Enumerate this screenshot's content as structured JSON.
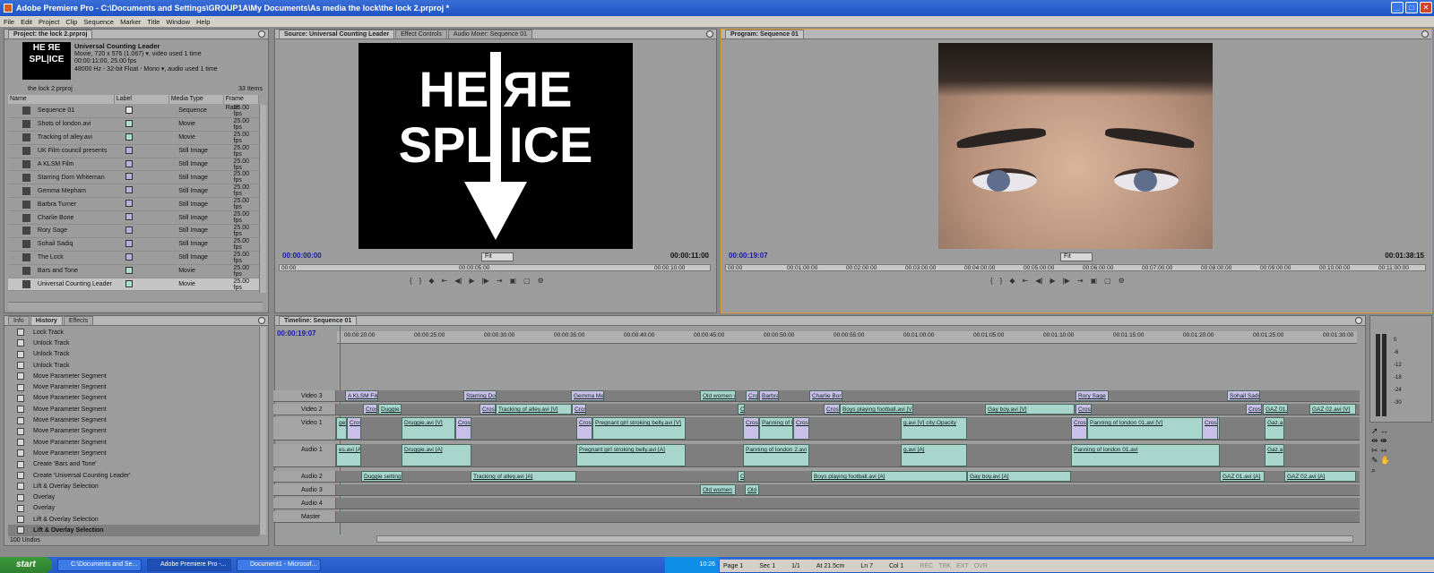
{
  "window": {
    "title": "Adobe Premiere Pro - C:\\Documents and Settings\\GROUP1A\\My Documents\\As media the lock\\the lock 2.prproj *",
    "buttons": [
      "_",
      "□",
      "✕"
    ]
  },
  "menu": [
    "File",
    "Edit",
    "Project",
    "Clip",
    "Sequence",
    "Marker",
    "Title",
    "Window",
    "Help"
  ],
  "project": {
    "tab": "Project: the lock 2.prproj",
    "thumb_lines": [
      "HE ЯE",
      "SPL|ICE"
    ],
    "preview": {
      "name": "Universal Counting Leader",
      "info1": "Movie, 720 x 576 (1.067)  ▾, video used 1 time",
      "info2": "00:00:11:00, 25.00 fps",
      "info3": "48000 Hz - 32-bit Float - Mono  ▾, audio used 1 time"
    },
    "bin_name": "the lock 2.prproj",
    "item_count": "33 Items",
    "columns": [
      "Name",
      "Label",
      "Media Type",
      "Frame Rate"
    ],
    "items": [
      {
        "name": "Sequence 01",
        "type": "Sequence",
        "rate": "25.00 fps",
        "color": "#e8e8e8"
      },
      {
        "name": "Shots of london.avi",
        "type": "Movie",
        "rate": "25.00 fps",
        "color": "#a8e0d0"
      },
      {
        "name": "Tracking of alley.avi",
        "type": "Movie",
        "rate": "25.00 fps",
        "color": "#a8e0d0"
      },
      {
        "name": "UK Film council presents",
        "type": "Still Image",
        "rate": "25.00 fps",
        "color": "#b8b0e0"
      },
      {
        "name": "A KLSM Film",
        "type": "Still Image",
        "rate": "25.00 fps",
        "color": "#b8b0e0"
      },
      {
        "name": "Starring Dom Whiteman",
        "type": "Still Image",
        "rate": "25.00 fps",
        "color": "#b8b0e0"
      },
      {
        "name": "Gemma Mepham",
        "type": "Still Image",
        "rate": "25.00 fps",
        "color": "#b8b0e0"
      },
      {
        "name": "Barbra Turner",
        "type": "Still Image",
        "rate": "25.00 fps",
        "color": "#b8b0e0"
      },
      {
        "name": "Charlie Bone",
        "type": "Still Image",
        "rate": "25.00 fps",
        "color": "#b8b0e0"
      },
      {
        "name": "Rory Sage",
        "type": "Still Image",
        "rate": "25.00 fps",
        "color": "#b8b0e0"
      },
      {
        "name": "Sohail Sadiq",
        "type": "Still Image",
        "rate": "25.00 fps",
        "color": "#b8b0e0"
      },
      {
        "name": "The Lock",
        "type": "Still Image",
        "rate": "25.00 fps",
        "color": "#b8b0e0"
      },
      {
        "name": "Bars and Tone",
        "type": "Movie",
        "rate": "25.00 fps",
        "color": "#a8e0d0"
      },
      {
        "name": "Universal Counting Leader",
        "type": "Movie",
        "rate": "25.00 fps",
        "color": "#a8e0d0"
      }
    ]
  },
  "history": {
    "tabs": [
      "Info",
      "History",
      "Effects"
    ],
    "items": [
      "Lock Track",
      "Unlock Track",
      "Unlock Track",
      "Unlock Track",
      "Move Parameter Segment",
      "Move Parameter Segment",
      "Move Parameter Segment",
      "Move Parameter Segment",
      "Move Parameter Segment",
      "Move Parameter Segment",
      "Move Parameter Segment",
      "Move Parameter Segment",
      "Create 'Bars and Tone'",
      "Create 'Universal Counting Leader'",
      "Lift & Overlay Selection",
      "Overlay",
      "Overlay",
      "Lift & Overlay Selection",
      "Lift & Overlay Selection"
    ],
    "footer": "100 Undos"
  },
  "source": {
    "tabs": [
      "Source: Universal Counting Leader",
      "Effect Controls",
      "Audio Mixer: Sequence 01"
    ],
    "frame_lines": [
      "HE ЯE",
      "SPL ICE"
    ],
    "tc_in": "00:00:00:00",
    "fit": "Fit",
    "duration": "00:00:11:00",
    "ruler": [
      "00:00",
      "00:00:05:00",
      "00:00:10:00"
    ]
  },
  "program": {
    "tab": "Program: Sequence 01",
    "tc_in": "00:00:19:07",
    "fit": "Fit",
    "duration": "00:01:38:15",
    "ruler": [
      "00:00",
      "00:01:00:00",
      "00:02:00:00",
      "00:03:00:00",
      "00:04:00:00",
      "00:05:00:00",
      "00:06:00:00",
      "00:07:00:00",
      "00:08:00:00",
      "00:09:00:00",
      "00:10:00:00",
      "00:11:00:00"
    ]
  },
  "timeline": {
    "tab": "Timeline: Sequence 01",
    "tc": "00:00:19:07",
    "ruler": [
      "00:00:20:00",
      "00:00:25:00",
      "00:00:30:00",
      "00:00:35:00",
      "00:00:40:00",
      "00:00:45:00",
      "00:00:50:00",
      "00:00:55:00",
      "00:01:00:00",
      "00:01:05:00",
      "00:01:10:00",
      "00:01:15:00",
      "00:01:20:00",
      "00:01:25:00",
      "00:01:30:00"
    ],
    "tracks": [
      "Video 3",
      "Video 2",
      "Video 1",
      "Audio 1",
      "Audio 2",
      "Audio 3",
      "Audio 4",
      "Master"
    ],
    "clips": {
      "v3": [
        "A KLSM Film",
        "Starring Do",
        "Gemma Mep",
        "Old women w",
        "Cros",
        "Barbra",
        "Charlie Bon",
        "Rory Sage",
        "Sohail Sadiq"
      ],
      "v2": [
        "Cross",
        "Duggie s",
        "Cross",
        "Tracking of alley.avi [V]",
        "Cross",
        "O",
        "Cross",
        "Boys playing football.avi [V",
        "Gay boy.avi [V]",
        "Cross",
        "Cross",
        "GAZ 01.a",
        "GAZ 02.avi [V]"
      ],
      "v1": [
        "ges",
        "Cross",
        "Druggie.avi [V]",
        "Cross",
        "Cross",
        "Pregnant girl stroking belly.avi [V]",
        "Cross",
        "Panning of l",
        "Cross",
        "g.avi [V] city:Opacity",
        "Cross",
        "Panning of london 01.avi [V]",
        "Cross",
        "Gaz.a"
      ],
      "a1": [
        "es.avi [A]",
        "Druggie.avi [A]",
        "Pregnant girl stroking belly.avi [A]",
        "Panning of london 2.avi",
        "g.avi [A]",
        "Panning of london 01.avi",
        "Gaz.a"
      ],
      "a2": [
        "Duggie setting",
        "Tracking of alley.avi [A]",
        "O",
        "Boys playing football.avi [A]",
        "Gay boy.avi [A]",
        "GAZ 01.avi [A]",
        "GAZ 02.avi [A]"
      ],
      "a3": [
        "Old women",
        "Old"
      ]
    },
    "meter": [
      "0",
      "-6",
      "-12",
      "-18",
      "-24",
      "-30"
    ]
  },
  "taskbar": {
    "start": "start",
    "buttons": [
      "C:\\Documents and Se...",
      "Adobe Premiere Pro -...",
      "Document1 - Microsof..."
    ],
    "time": "10:26"
  },
  "word_status": {
    "page": "Page 1",
    "sec": "Sec 1",
    "pages": "1/1",
    "at": "At 21.5cm",
    "ln": "Ln 7",
    "col": "Col 1",
    "modes": [
      "REC",
      "TRK",
      "EXT",
      "OVR"
    ]
  }
}
